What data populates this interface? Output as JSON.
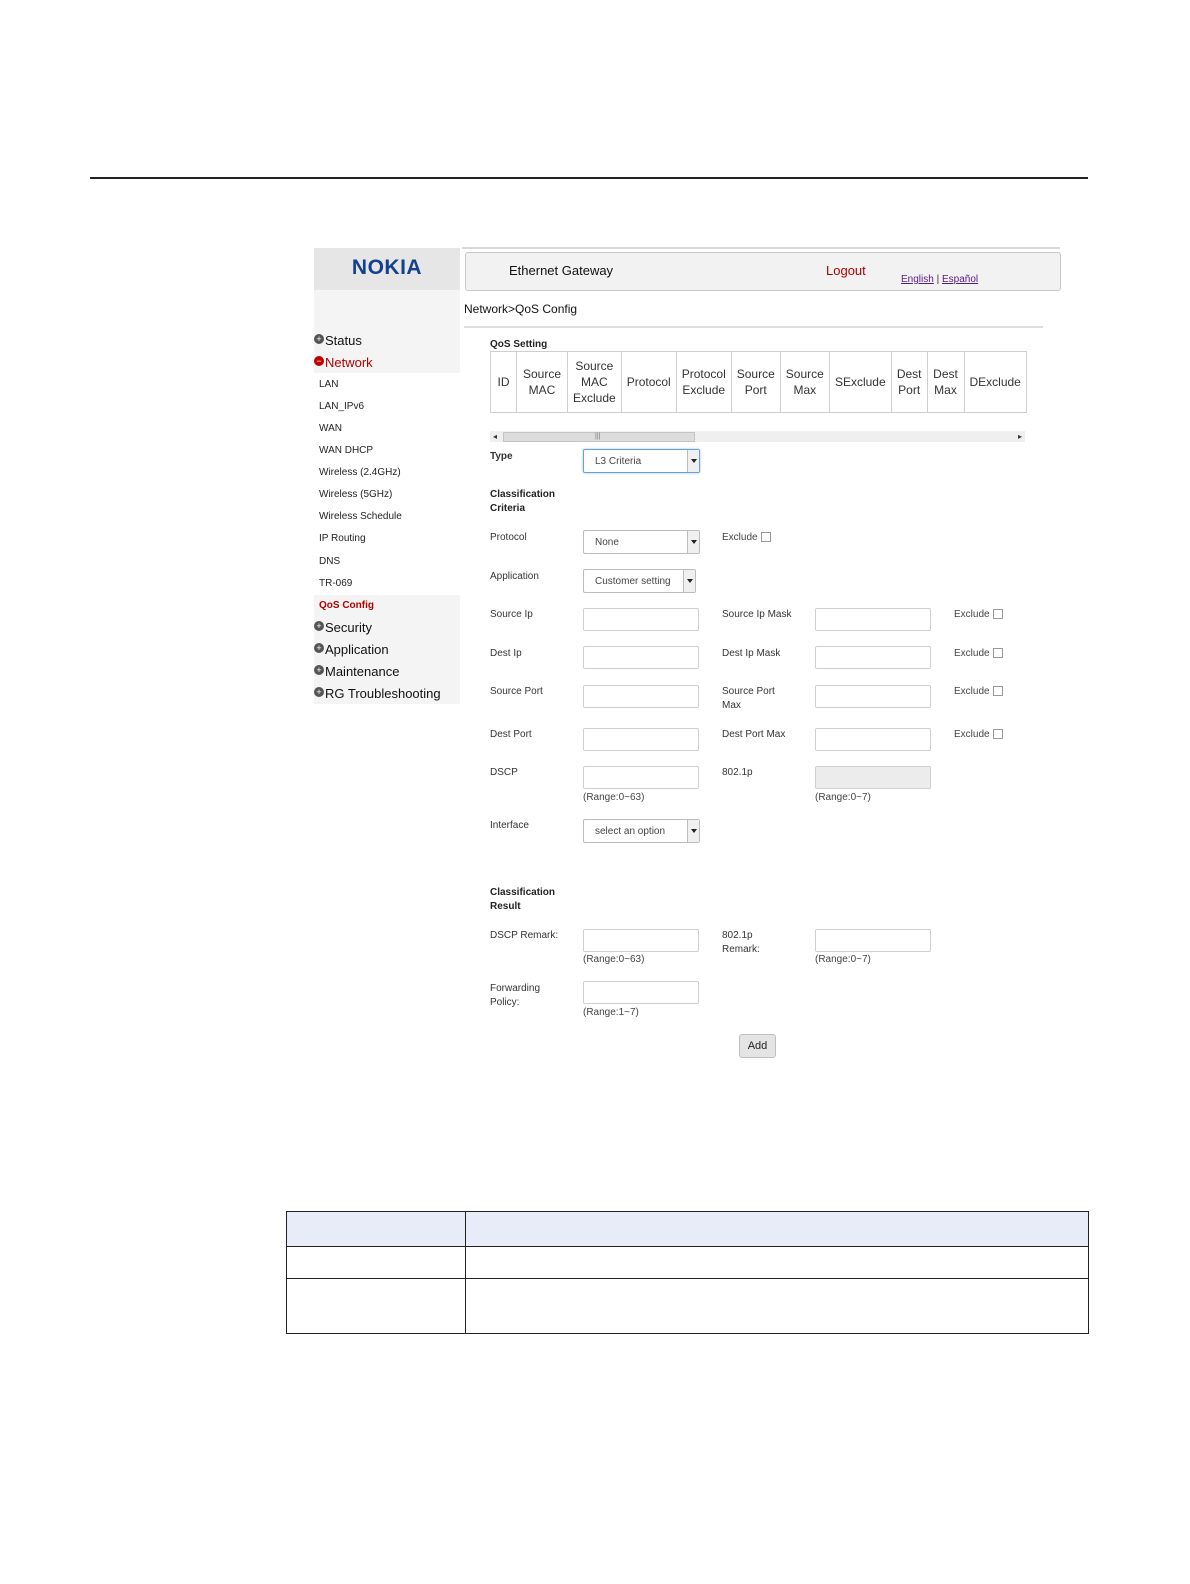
{
  "sidebar": {
    "logo": "NOKIA",
    "items": [
      {
        "label": "Status",
        "icon": "plus-circle-icon"
      },
      {
        "label": "Network",
        "icon": "minus-circle-icon",
        "active": true
      },
      {
        "label": "Security",
        "icon": "plus-circle-icon"
      },
      {
        "label": "Application",
        "icon": "plus-circle-icon"
      },
      {
        "label": "Maintenance",
        "icon": "plus-circle-icon"
      },
      {
        "label": "RG Troubleshooting",
        "icon": "plus-circle-icon"
      }
    ],
    "network_subitems": [
      "LAN",
      "LAN_IPv6",
      "WAN",
      "WAN DHCP",
      "Wireless (2.4GHz)",
      "Wireless (5GHz)",
      "Wireless Schedule",
      "IP Routing",
      "DNS",
      "TR-069",
      "QoS Config"
    ],
    "active_subitem": "QoS Config"
  },
  "header": {
    "title": "Ethernet Gateway",
    "logout": "Logout",
    "lang_english": "English",
    "lang_separator": "|",
    "lang_spanish": "Español"
  },
  "breadcrumb": "Network>QoS Config",
  "qos_setting": {
    "title": "QoS Setting",
    "columns": [
      "ID",
      "Source MAC",
      "Source MAC Exclude",
      "Protocol",
      "Protocol Exclude",
      "Source Port",
      "Source Max",
      "SExclude",
      "Dest Port",
      "Dest Max",
      "DExclude"
    ]
  },
  "form": {
    "type_label": "Type",
    "type_value": "L3 Criteria",
    "criteria_title": "Classification Criteria",
    "protocol_label": "Protocol",
    "protocol_value": "None",
    "exclude_label": "Exclude",
    "application_label": "Application",
    "application_value": "Customer setting",
    "source_ip_label": "Source Ip",
    "source_ip_mask_label": "Source Ip Mask",
    "dest_ip_label": "Dest Ip",
    "dest_ip_mask_label": "Dest Ip Mask",
    "source_port_label": "Source Port",
    "source_port_max_label": "Source Port Max",
    "dest_port_label": "Dest Port",
    "dest_port_max_label": "Dest Port Max",
    "dscp_label": "DSCP",
    "dscp_range": "(Range:0~63)",
    "p8021_label": "802.1p",
    "p8021_range": "(Range:0~7)",
    "interface_label": "Interface",
    "interface_value": "select an option",
    "result_title": "Classification Result",
    "dscp_remark_label": "DSCP Remark:",
    "dscp_remark_range": "(Range:0~63)",
    "p8021_remark_label": "802.1p Remark:",
    "p8021_remark_range": "(Range:0~7)",
    "forwarding_label": "Forwarding Policy:",
    "forwarding_range": "(Range:1~7)",
    "add_button": "Add"
  },
  "colors": {
    "brand": "#124191",
    "active_red": "#b00000",
    "link_purple": "#551a8b",
    "doc_table_header": "#e8ecf8"
  }
}
